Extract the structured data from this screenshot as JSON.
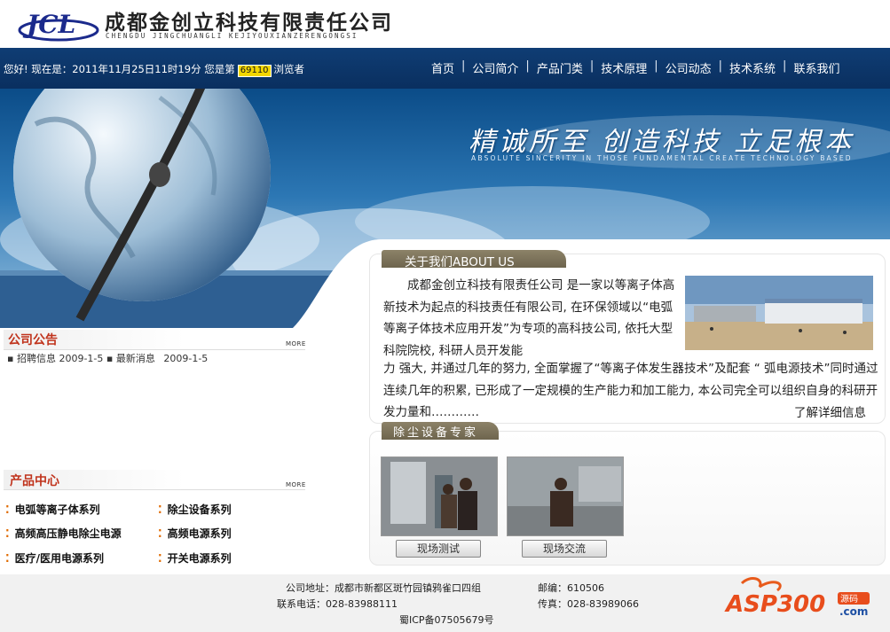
{
  "header": {
    "company_name": "成都金创立科技有限责任公司",
    "company_pinyin": "CHENGDU JINGCHUANGLI KEJIYOUXIANZERENGONGSI",
    "logo_text": "JCL"
  },
  "topbar": {
    "welcome": "您好! 现在是：2011年11月25日11时19分  您是第",
    "visit_count": "69110",
    "visitor_suffix": "浏览者"
  },
  "nav": {
    "items": [
      "首页",
      "公司简介",
      "产品门类",
      "技术原理",
      "公司动态",
      "技术系统",
      "联系我们"
    ],
    "separator": "|"
  },
  "banner": {
    "slogan": "精诚所至 创造科技 立足根本",
    "slogan_en": "ABSOLUTE SINCERITY IN THOSE FUNDAMENTAL CREATE TECHNOLOGY BASED"
  },
  "notice": {
    "title": "公司公告",
    "more": "MORE",
    "items": [
      {
        "label": "招聘信息",
        "date": "2009-1-5"
      },
      {
        "label": "最新消息",
        "date": "2009-1-5"
      }
    ]
  },
  "products": {
    "title": "产品中心",
    "more": "MORE",
    "items": [
      "电弧等离子体系列",
      "除尘设备系列",
      "高频高压静电除尘电源",
      "高频电源系列",
      "医疗/医用电源系列",
      "开关电源系列"
    ]
  },
  "about": {
    "title": "关于我们ABOUT US",
    "paragraph_1": "成都金创立科技有限责任公司 是一家以等离子体高新技术为起点的科技责任有限公司, 在环保领域以“电弧等离子体技术应用开发”为专项的高科技公司, 依托大型科院院校, 科研人员开发能",
    "paragraph_2": "力 强大, 并通过几年的努力, 全面掌握了“等离子体发生器技术”及配套 “ 弧电源技术”同时通过连续几年的积累, 已形成了一定规模的生产能力和加工能力, 本公司完全可以组织自身的科研开发力量和…………",
    "more_link": "了解详细信息"
  },
  "dust": {
    "title": "除尘设备专家",
    "photos": [
      {
        "caption": "现场测试"
      },
      {
        "caption": "现场交流"
      }
    ]
  },
  "footer": {
    "address": "公司地址：成都市新都区斑竹园镇鸦雀口四组",
    "postcode": "邮编：610506",
    "phone": "联系电话：028-83988111",
    "fax": "传真：028-83989066",
    "icp": "蜀ICP备07505679号"
  },
  "watermark": {
    "logo_text": "ASP300",
    "sub1": "源码",
    "sub2": ".com"
  },
  "colors": {
    "nav_bg": "#0f3d74",
    "section_title": "#c0331c",
    "tab_bg": "#7a705a",
    "bullet": "#e06a00"
  }
}
